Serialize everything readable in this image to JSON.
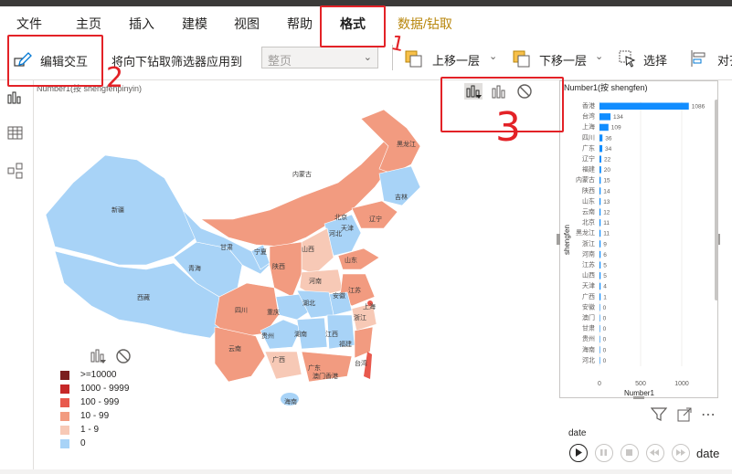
{
  "ribbon": {
    "tabs": [
      {
        "label": "文件"
      },
      {
        "label": "主页"
      },
      {
        "label": "插入"
      },
      {
        "label": "建模"
      },
      {
        "label": "视图"
      },
      {
        "label": "帮助"
      },
      {
        "label": "格式"
      },
      {
        "label": "数据/钻取"
      }
    ]
  },
  "toolbar": {
    "edit_interactions_label": "编辑交互",
    "drill_filter_label": "将向下钻取筛选器应用到",
    "drill_filter_value": "整页",
    "bring_forward_label": "上移一层",
    "send_backward_label": "下移一层",
    "select_label": "选择",
    "align_label": "对齐"
  },
  "annotations": {
    "a1": "1",
    "a2": "2",
    "a3": "3"
  },
  "map": {
    "title": "Number1(按 shengfenpinyin)",
    "provinces": [
      "黑龙江",
      "吉林",
      "辽宁",
      "内蒙古",
      "新疆",
      "西藏",
      "青海",
      "甘肃",
      "宁夏",
      "陕西",
      "山西",
      "河北",
      "北京",
      "天津",
      "山东",
      "河南",
      "江苏",
      "安徽",
      "湖北",
      "四川",
      "重庆",
      "贵州",
      "云南",
      "湖南",
      "江西",
      "浙江",
      "上海",
      "福建",
      "广西",
      "广东",
      "台湾",
      "海南",
      "澳门",
      "香港"
    ],
    "legend": [
      {
        "label": ">=10000",
        "color": "#7b1e1e"
      },
      {
        "label": "1000 - 9999",
        "color": "#c62828"
      },
      {
        "label": "100 - 999",
        "color": "#e8594d"
      },
      {
        "label": "10 - 99",
        "color": "#f29b80"
      },
      {
        "label": "1 - 9",
        "color": "#f7c9b6"
      },
      {
        "label": "0",
        "color": "#a8d3f7"
      }
    ]
  },
  "chart_data": {
    "type": "bar",
    "title": "Number1(按 shengfen)",
    "ylabel": "shengfen",
    "xlabel": "Number1",
    "xlim": [
      0,
      1100
    ],
    "xticks": [
      "0",
      "500",
      "1000"
    ],
    "categories": [
      "香港",
      "台湾",
      "上海",
      "四川",
      "广东",
      "辽宁",
      "福建",
      "内蒙古",
      "陕西",
      "山东",
      "云南",
      "北京",
      "黑龙江",
      "浙江",
      "河南",
      "江苏",
      "山西",
      "天津",
      "广西",
      "安徽",
      "澳门",
      "甘肃",
      "贵州",
      "海南",
      "河北"
    ],
    "values": [
      1086,
      134,
      109,
      36,
      34,
      22,
      20,
      15,
      14,
      13,
      12,
      11,
      11,
      9,
      6,
      5,
      5,
      4,
      1,
      0,
      0,
      0,
      0,
      0,
      0
    ]
  },
  "playback": {
    "field_label": "date",
    "axis_label": "date"
  }
}
